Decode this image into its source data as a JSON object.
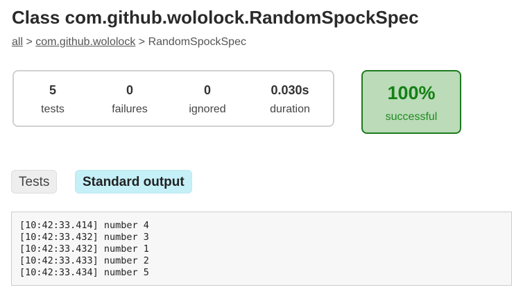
{
  "page": {
    "title": "Class com.github.wololock.RandomSpockSpec"
  },
  "breadcrumb": {
    "all_link": "all",
    "separator1": " > ",
    "package_link": "com.github.wololock",
    "separator2": " > ",
    "current": "RandomSpockSpec"
  },
  "summary": {
    "tests": {
      "value": "5",
      "label": "tests"
    },
    "failures": {
      "value": "0",
      "label": "failures"
    },
    "ignored": {
      "value": "0",
      "label": "ignored"
    },
    "duration": {
      "value": "0.030s",
      "label": "duration"
    }
  },
  "success": {
    "percent": "100%",
    "label": "successful"
  },
  "tabs": [
    {
      "label": "Tests",
      "selected": false
    },
    {
      "label": "Standard output",
      "selected": true
    }
  ],
  "standard_output": {
    "lines": [
      "[10:42:33.414] number 4",
      "[10:42:33.432] number 3",
      "[10:42:33.432] number 1",
      "[10:42:33.433] number 2",
      "[10:42:33.434] number 5"
    ]
  },
  "colors": {
    "success_bg": "#bbdbb9",
    "success_border": "#1d7a1d",
    "success_text": "#138013",
    "selected_tab_bg": "#c6f0f8"
  }
}
